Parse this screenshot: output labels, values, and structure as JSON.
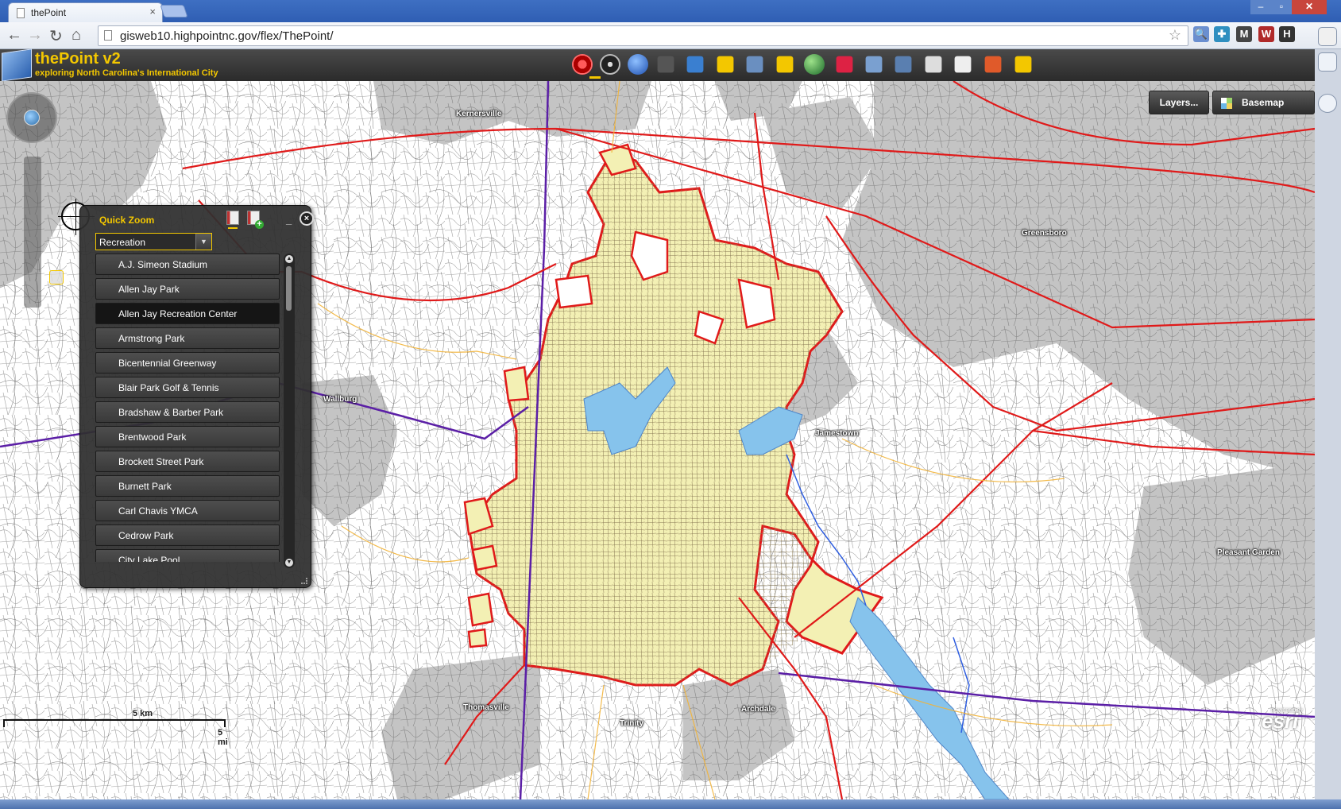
{
  "browser": {
    "tab_title": "thePoint",
    "tab_close": "×",
    "url": "gisweb10.highpointnc.gov/flex/ThePoint/",
    "nav_back": "←",
    "nav_forward": "→",
    "nav_reload": "↻",
    "nav_home": "⌂",
    "star": "☆",
    "window_min": "–",
    "window_max": "▫",
    "window_close": "✕",
    "extensions": [
      {
        "name": "search-ext-icon",
        "glyph": "🔍",
        "color": "#6a8fd0"
      },
      {
        "name": "puzzle-ext-icon",
        "glyph": "✚",
        "color": "#2f8fc0"
      },
      {
        "name": "gmail-ext-icon",
        "glyph": "M",
        "color": "#444444"
      },
      {
        "name": "news-ext-icon",
        "glyph": "W",
        "color": "#b02a2a"
      },
      {
        "name": "h-ext-icon",
        "glyph": "H",
        "color": "#333333"
      }
    ]
  },
  "app": {
    "title": "thePoint v2",
    "subtitle": "exploring North Carolina's International City",
    "tools": [
      {
        "name": "target-tool-icon",
        "color": "#d22"
      },
      {
        "name": "navigate-tool-icon",
        "color": "#222"
      },
      {
        "name": "info-tool-icon",
        "color": "#2a6fd6"
      },
      {
        "name": "binoculars-tool-icon",
        "color": "#555"
      },
      {
        "name": "table-tool-icon",
        "color": "#3a7fd0"
      },
      {
        "name": "move-tool-icon",
        "color": "#f3c700"
      },
      {
        "name": "layers-tool-icon",
        "color": "#6a8fc0"
      },
      {
        "name": "lock-tool-icon",
        "color": "#f3c700"
      },
      {
        "name": "globe-tool-icon",
        "color": "#2a8f3a"
      },
      {
        "name": "measure-tool-icon",
        "color": "#d24"
      },
      {
        "name": "draw-tool-icon",
        "color": "#7aa0d0"
      },
      {
        "name": "print-tool-icon",
        "color": "#5a7fb0"
      },
      {
        "name": "select-tool-icon",
        "color": "#ddd"
      },
      {
        "name": "download-tool-icon",
        "color": "#eee"
      },
      {
        "name": "report-tool-icon",
        "color": "#e05a2a"
      },
      {
        "name": "key-tool-icon",
        "color": "#f3c700"
      }
    ]
  },
  "map": {
    "layers_label": "Layers...",
    "basemap_label": "Basemap",
    "labels": [
      {
        "name": "label-kernersville",
        "text": "Kernersville"
      },
      {
        "name": "label-greensboro",
        "text": "Greensboro"
      },
      {
        "name": "label-wallburg",
        "text": "Wallburg"
      },
      {
        "name": "label-jamestown",
        "text": "Jamestown"
      },
      {
        "name": "label-pleasant-garden",
        "text": "Pleasant Garden"
      },
      {
        "name": "label-thomasville",
        "text": "Thomasville"
      },
      {
        "name": "label-archdale",
        "text": "Archdale"
      },
      {
        "name": "label-trinity",
        "text": "Trinity"
      }
    ],
    "scale_km": "5 km",
    "scale_mi": "5 mi",
    "esri_text": "esri",
    "esri_powered": "POWERED BY"
  },
  "quick_zoom": {
    "title": "Quick Zoom",
    "minimize": "_",
    "close": "×",
    "category": "Recreation",
    "selected_index": 2,
    "items": [
      "A.J. Simeon Stadium",
      "Allen Jay Park",
      "Allen Jay Recreation Center",
      "Armstrong Park",
      "Bicentennial Greenway",
      "Blair Park Golf & Tennis",
      "Bradshaw & Barber Park",
      "Brentwood Park",
      "Brockett Street Park",
      "Burnett Park",
      "Carl Chavis YMCA",
      "Cedrow Park",
      "City Lake Pool"
    ]
  },
  "colors": {
    "accent": "#f3c700",
    "city_fill": "#f3f0b4",
    "city_border": "#e01a1a",
    "urban_gray": "#c4c4c4",
    "water": "#86c3ec",
    "county_line": "#5b1fa6"
  }
}
